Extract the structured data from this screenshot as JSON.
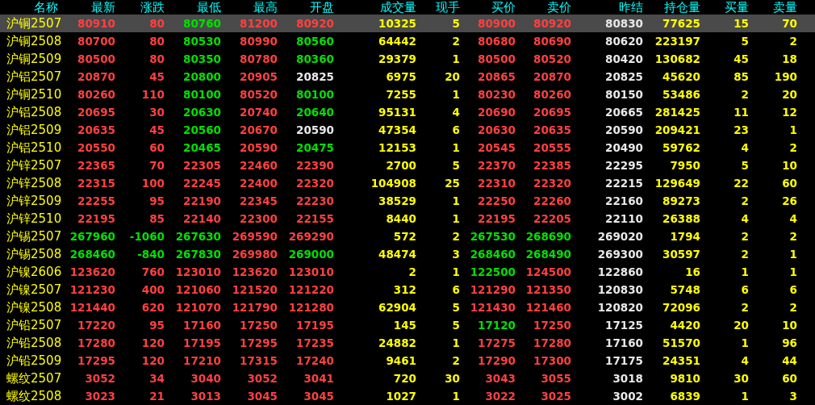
{
  "table": {
    "columns": [
      "名称",
      "最新",
      "涨跌",
      "最低",
      "最高",
      "开盘",
      "成交量",
      "现手",
      "买价",
      "卖价",
      "昨结",
      "持仓量",
      "买量",
      "卖量"
    ],
    "rows": [
      {
        "selected": true,
        "cells": [
          "沪铜2507",
          "80910",
          "80",
          "80760",
          "81200",
          "80920",
          "10325",
          "5",
          "80900",
          "80920",
          "80830",
          "77625",
          "15",
          "70"
        ]
      },
      {
        "selected": false,
        "cells": [
          "沪铜2508",
          "80700",
          "80",
          "80530",
          "80990",
          "80560",
          "64442",
          "2",
          "80680",
          "80690",
          "80620",
          "223197",
          "5",
          "2"
        ]
      },
      {
        "selected": false,
        "cells": [
          "沪铜2509",
          "80500",
          "80",
          "80350",
          "80780",
          "80360",
          "29379",
          "1",
          "80500",
          "80520",
          "80420",
          "130682",
          "45",
          "18"
        ]
      },
      {
        "selected": false,
        "cells": [
          "沪铝2507",
          "20870",
          "45",
          "20800",
          "20905",
          "20825",
          "6975",
          "20",
          "20865",
          "20870",
          "20825",
          "45620",
          "85",
          "190"
        ]
      },
      {
        "selected": false,
        "cells": [
          "沪铜2510",
          "80260",
          "110",
          "80100",
          "80520",
          "80100",
          "7255",
          "1",
          "80230",
          "80260",
          "80150",
          "53486",
          "2",
          "20"
        ]
      },
      {
        "selected": false,
        "cells": [
          "沪铝2508",
          "20695",
          "30",
          "20630",
          "20740",
          "20640",
          "95131",
          "4",
          "20690",
          "20695",
          "20665",
          "281425",
          "11",
          "12"
        ]
      },
      {
        "selected": false,
        "cells": [
          "沪铝2509",
          "20635",
          "45",
          "20560",
          "20670",
          "20590",
          "47354",
          "6",
          "20630",
          "20635",
          "20590",
          "209421",
          "23",
          "1"
        ]
      },
      {
        "selected": false,
        "cells": [
          "沪铝2510",
          "20550",
          "60",
          "20465",
          "20590",
          "20475",
          "12153",
          "1",
          "20545",
          "20555",
          "20490",
          "59762",
          "4",
          "2"
        ]
      },
      {
        "selected": false,
        "cells": [
          "沪锌2507",
          "22365",
          "70",
          "22305",
          "22460",
          "22390",
          "2700",
          "5",
          "22370",
          "22385",
          "22295",
          "7950",
          "5",
          "10"
        ]
      },
      {
        "selected": false,
        "cells": [
          "沪锌2508",
          "22315",
          "100",
          "22245",
          "22400",
          "22320",
          "104908",
          "25",
          "22310",
          "22320",
          "22215",
          "129649",
          "22",
          "60"
        ]
      },
      {
        "selected": false,
        "cells": [
          "沪锌2509",
          "22255",
          "95",
          "22190",
          "22345",
          "22230",
          "38529",
          "1",
          "22250",
          "22260",
          "22160",
          "89273",
          "2",
          "26"
        ]
      },
      {
        "selected": false,
        "cells": [
          "沪锌2510",
          "22195",
          "85",
          "22140",
          "22300",
          "22155",
          "8440",
          "1",
          "22195",
          "22205",
          "22110",
          "26388",
          "4",
          "4"
        ]
      },
      {
        "selected": false,
        "cells": [
          "沪锡2507",
          "267960",
          "-1060",
          "267630",
          "269590",
          "269290",
          "572",
          "2",
          "267530",
          "268690",
          "269020",
          "1794",
          "2",
          "2"
        ]
      },
      {
        "selected": false,
        "cells": [
          "沪锡2508",
          "268460",
          "-840",
          "267830",
          "269980",
          "269000",
          "48474",
          "3",
          "268460",
          "268490",
          "269300",
          "30597",
          "2",
          "1"
        ]
      },
      {
        "selected": false,
        "cells": [
          "沪镍2606",
          "123620",
          "760",
          "123010",
          "123620",
          "123010",
          "2",
          "1",
          "122500",
          "124500",
          "122860",
          "16",
          "1",
          "1"
        ]
      },
      {
        "selected": false,
        "cells": [
          "沪镍2507",
          "121230",
          "400",
          "121060",
          "121520",
          "121220",
          "312",
          "6",
          "121290",
          "121350",
          "120830",
          "5748",
          "6",
          "6"
        ]
      },
      {
        "selected": false,
        "cells": [
          "沪镍2508",
          "121440",
          "620",
          "121070",
          "121790",
          "121280",
          "62904",
          "5",
          "121430",
          "121460",
          "120820",
          "72096",
          "2",
          "2"
        ]
      },
      {
        "selected": false,
        "cells": [
          "沪铅2507",
          "17220",
          "95",
          "17160",
          "17250",
          "17195",
          "145",
          "5",
          "17120",
          "17250",
          "17125",
          "4420",
          "20",
          "10"
        ]
      },
      {
        "selected": false,
        "cells": [
          "沪铅2508",
          "17280",
          "120",
          "17195",
          "17295",
          "17235",
          "24882",
          "1",
          "17275",
          "17280",
          "17160",
          "51570",
          "1",
          "96"
        ]
      },
      {
        "selected": false,
        "cells": [
          "沪铅2509",
          "17295",
          "120",
          "17210",
          "17315",
          "17240",
          "9461",
          "2",
          "17290",
          "17300",
          "17175",
          "24351",
          "4",
          "44"
        ]
      },
      {
        "selected": false,
        "cells": [
          "螺纹2507",
          "3052",
          "34",
          "3040",
          "3052",
          "3041",
          "720",
          "30",
          "3043",
          "3055",
          "3018",
          "9810",
          "30",
          "60"
        ]
      },
      {
        "selected": false,
        "cells": [
          "螺纹2508",
          "3023",
          "21",
          "3013",
          "3045",
          "3045",
          "1027",
          "1",
          "3022",
          "3025",
          "3002",
          "6839",
          "1",
          "3"
        ]
      }
    ]
  }
}
